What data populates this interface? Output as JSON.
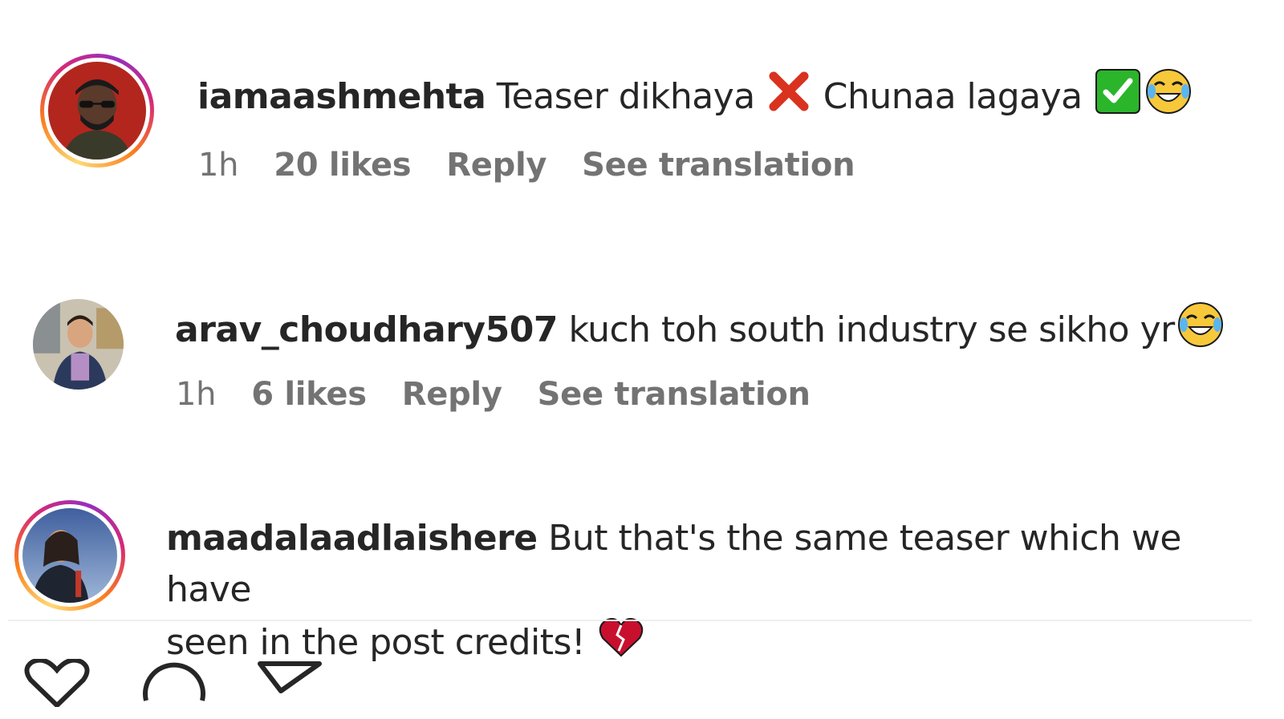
{
  "comments": [
    {
      "username": "iamaashmehta",
      "text_before": "Teaser dikhaya",
      "emoji1": "cross-mark",
      "text_middle": "Chunaa lagaya",
      "emoji2": "check-box",
      "emoji3": "tears-of-joy",
      "time": "1h",
      "likes": "20 likes",
      "reply": "Reply",
      "translate": "See translation",
      "story_ring": true
    },
    {
      "username": "arav_choudhary507",
      "text": "kuch toh south industry se sikho yr",
      "emoji": "tears-of-joy",
      "time": "1h",
      "likes": "6 likes",
      "reply": "Reply",
      "translate": "See translation",
      "story_ring": false
    },
    {
      "username": "maadalaadlaishere",
      "text_line1": "But that's the same teaser which we have",
      "text_line2": "seen in the post credits!",
      "emoji": "broken-heart",
      "story_ring": true
    }
  ],
  "actions": [
    "like-icon",
    "comment-icon",
    "share-icon"
  ],
  "colors": {
    "meta_gray": "#737373",
    "text": "#262626",
    "ring_start": "#feda75",
    "ring_end": "#962fbf"
  }
}
